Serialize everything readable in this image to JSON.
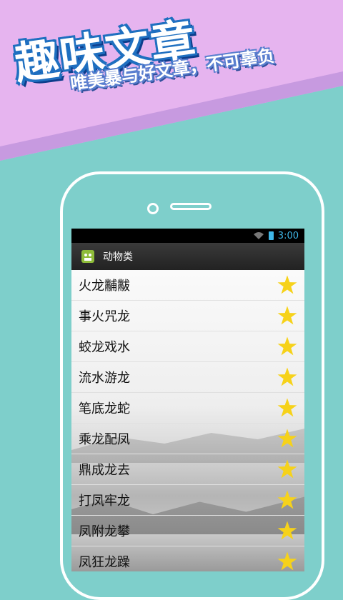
{
  "promo": {
    "headline": "趣味文章",
    "subline": "唯美暴与好文章，不可辜负"
  },
  "status": {
    "time": "3:00"
  },
  "appbar": {
    "title": "动物类"
  },
  "items": [
    {
      "label": "火龙黼黻"
    },
    {
      "label": "事火咒龙"
    },
    {
      "label": "蛟龙戏水"
    },
    {
      "label": "流水游龙"
    },
    {
      "label": "笔底龙蛇"
    },
    {
      "label": "乘龙配凤"
    },
    {
      "label": "鼎成龙去"
    },
    {
      "label": "打凤牢龙"
    },
    {
      "label": "凤附龙攀"
    },
    {
      "label": "凤狂龙躁"
    }
  ],
  "icons": {
    "star": "star-icon",
    "android": "android-icon",
    "wifi": "wifi-icon",
    "battery": "battery-icon"
  },
  "colors": {
    "background": "#7ecfcb",
    "banner_top": "#e8b6f0",
    "accent": "#3fb7e8",
    "star": "#f6d21a"
  }
}
